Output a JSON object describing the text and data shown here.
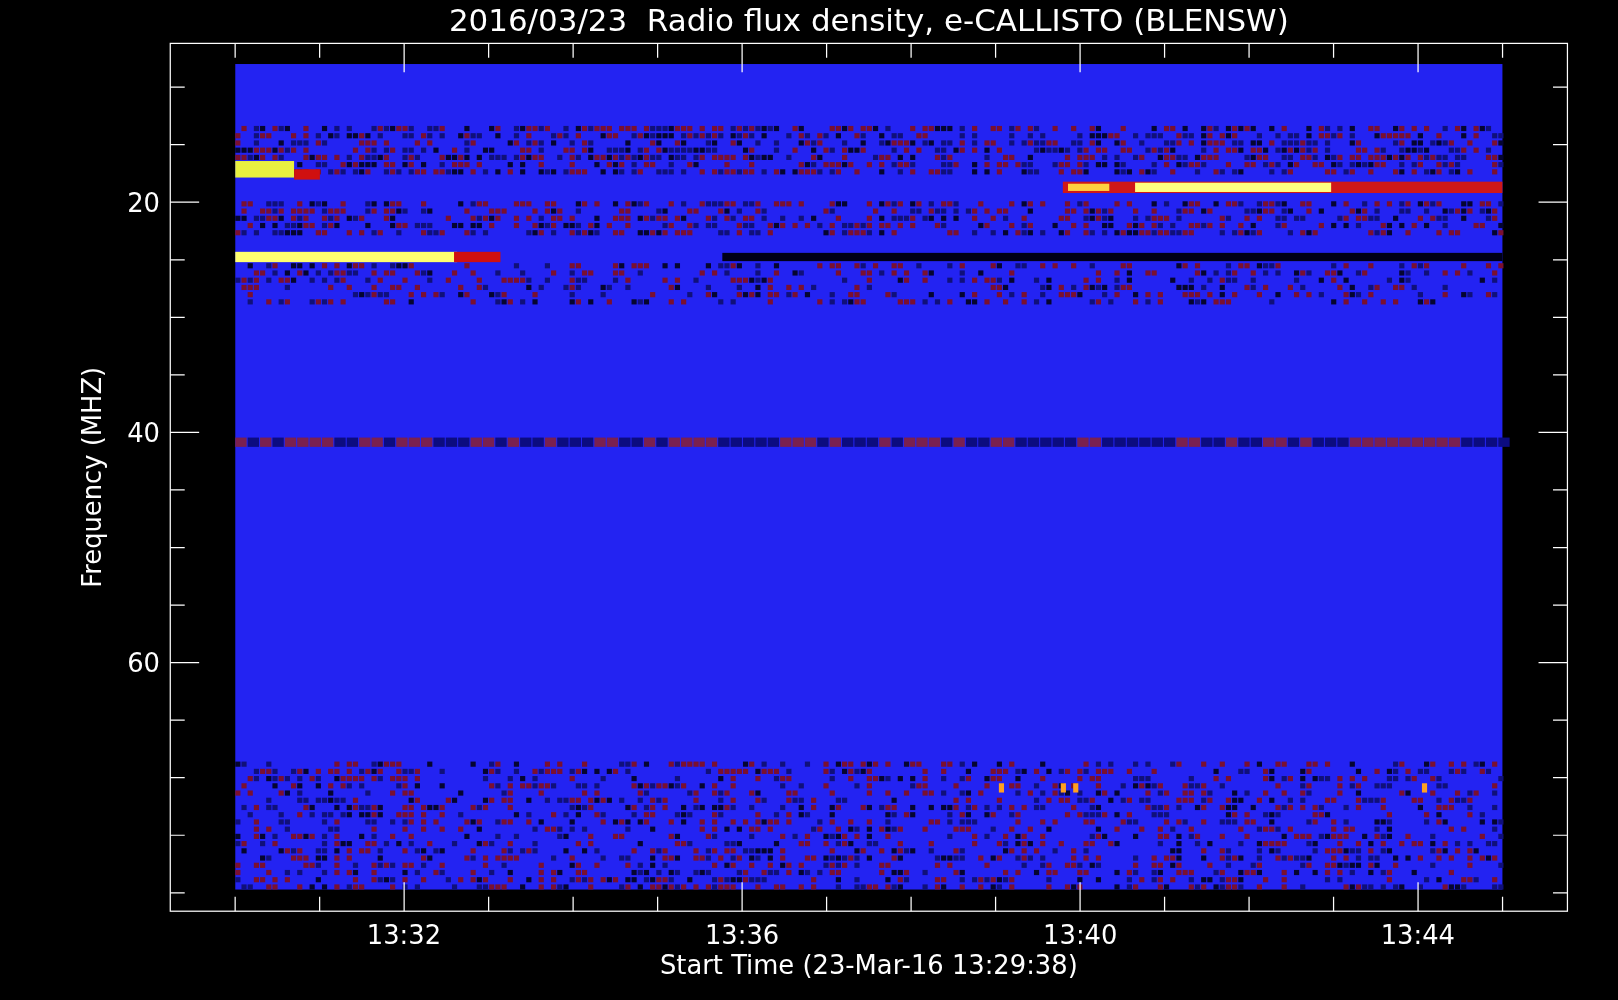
{
  "chart_data": {
    "type": "scatter",
    "title": "2016/03/23  Radio flux density, e-CALLISTO (BLENSW)",
    "xlabel": "Start Time (23-Mar-16 13:29:38)",
    "ylabel": "Frequency (MHZ)",
    "xlim": [
      13.4872,
      13.7628
    ],
    "ylim": [
      81.6,
      6.2
    ],
    "xticks": [
      {
        "value": 13.5333,
        "label": "13:32"
      },
      {
        "value": 13.6,
        "label": "13:36"
      },
      {
        "value": 13.6667,
        "label": "13:40"
      },
      {
        "value": 13.7333,
        "label": "13:44"
      }
    ],
    "yticks": [
      {
        "value": 20,
        "label": "20"
      },
      {
        "value": 40,
        "label": "40"
      },
      {
        "value": 60,
        "label": "60"
      }
    ]
  }
}
